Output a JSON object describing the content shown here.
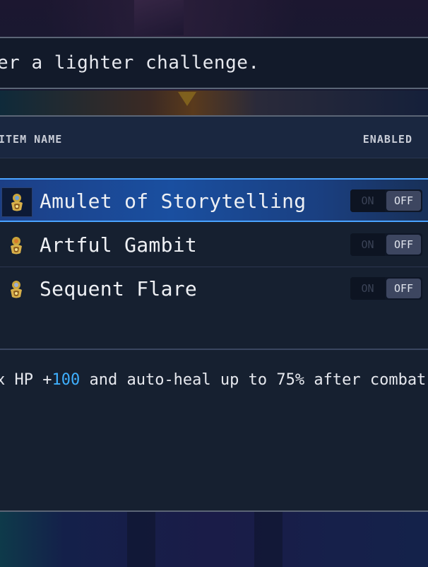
{
  "hint": {
    "text": "er a lighter challenge."
  },
  "table": {
    "col_name": "ITEM NAME",
    "col_enabled": "ENABLED"
  },
  "items": [
    {
      "label": "Amulet of Storytelling",
      "on_label": "ON",
      "off_label": "OFF",
      "icon": "amulet-icon",
      "selected": true,
      "enabled": false
    },
    {
      "label": "Artful Gambit",
      "on_label": "ON",
      "off_label": "OFF",
      "icon": "amulet-icon",
      "selected": false,
      "enabled": false
    },
    {
      "label": "Sequent Flare",
      "on_label": "ON",
      "off_label": "OFF",
      "icon": "amulet-icon",
      "selected": false,
      "enabled": false
    }
  ],
  "description": {
    "prefix": "x HP +",
    "value": "100",
    "suffix": " and auto-heal up to 75% after combat"
  },
  "colors": {
    "highlight": "#3fb0ff",
    "selected_border": "#4aa3ff",
    "panel_bg": "#162030"
  }
}
